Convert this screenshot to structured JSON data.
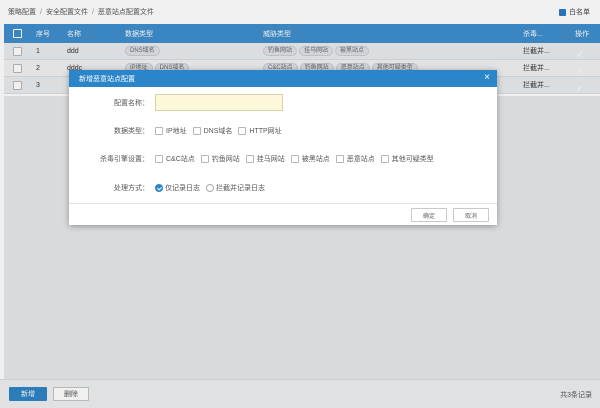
{
  "breadcrumb": [
    "策略配置",
    "安全配置文件",
    "恶意站点配置文件"
  ],
  "whitelist_label": "白名单",
  "table": {
    "headers": [
      "序号",
      "名称",
      "数据类型",
      "威胁类型",
      "杀毒...",
      "操作"
    ],
    "rows": [
      {
        "no": "1",
        "name": "ddd",
        "data_types": [
          "DNS域名"
        ],
        "threat_types": [
          "钓鱼网站",
          "挂马网站",
          "被黑站点"
        ],
        "action": "拦截并..."
      },
      {
        "no": "2",
        "name": "dddc",
        "data_types": [
          "IP地址",
          "DNS域名"
        ],
        "threat_types": [
          "C&C站点",
          "钓鱼网站",
          "恶意站点",
          "其他可疑类型"
        ],
        "action": "拦截并..."
      },
      {
        "no": "3",
        "name": "",
        "data_types": [],
        "threat_types": [],
        "action": "拦截并..."
      }
    ]
  },
  "footer": {
    "add_label": "新增",
    "delete_label": "删除",
    "total_text": "共3条记录"
  },
  "modal": {
    "title": "新增恶意站点配置",
    "close_glyph": "×",
    "name_label": "配置名称：",
    "name_value": "",
    "data_type_label": "数据类型：",
    "data_type_options": [
      "IP地址",
      "DNS域名",
      "HTTP网址"
    ],
    "engine_label": "杀毒引擎设置：",
    "engine_options": [
      "C&C站点",
      "钓鱼网站",
      "挂马网站",
      "被黑站点",
      "恶意站点",
      "其他可疑类型"
    ],
    "action_label": "处理方式：",
    "action_options": [
      "仅记录日志",
      "拦截并记录日志"
    ],
    "action_selected": "仅记录日志",
    "confirm_label": "确定",
    "cancel_label": "取消"
  },
  "colors": {
    "header_blue": "#3f8fcc",
    "modal_blue": "#2a86c9",
    "input_bg": "#fdf7d9"
  }
}
